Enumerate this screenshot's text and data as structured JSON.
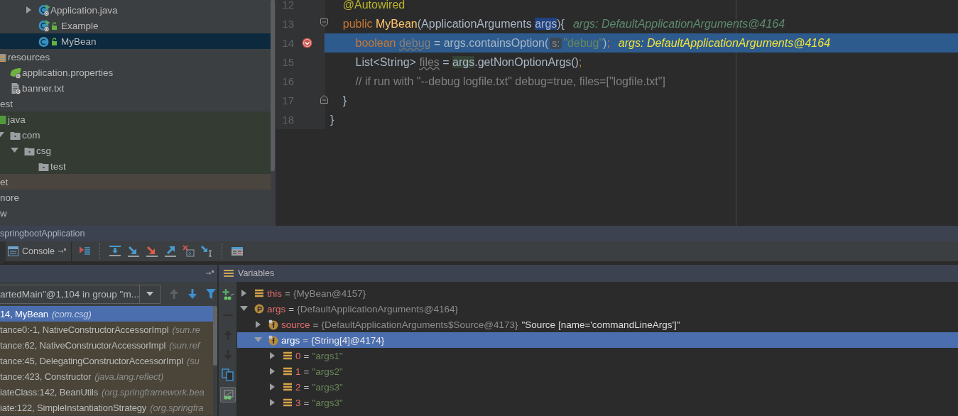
{
  "project_tree": [
    {
      "children": [
        {
          "children": [
            {
              "children": [
                {
                  "children": [
                    {
                      "label": "Application.java",
                      "kind": "spring-app",
                      "expanded": false,
                      "selected": false
                    },
                    {
                      "label": "Example",
                      "kind": "spring-app-public",
                      "selected": false
                    },
                    {
                      "label": "MyBean",
                      "kind": "class-public",
                      "selected": true
                    }
                  ]
                }
              ]
            }
          ]
        },
        {
          "label": "resources",
          "kind": "resources-folder",
          "selected": false,
          "children": [
            {
              "label": "application.properties",
              "kind": "spring-properties",
              "selected": false
            },
            {
              "label": "banner.txt",
              "kind": "text-file",
              "selected": false
            }
          ]
        }
      ]
    },
    {
      "label": "est",
      "selected": false,
      "children": [
        {
          "label": "java",
          "kind": "test-root",
          "selected": false,
          "children": [
            {
              "label": "com",
              "kind": "test-package",
              "expanded": true,
              "selected": false,
              "children": [
                {
                  "label": "csg",
                  "kind": "test-package",
                  "expanded": true,
                  "selected": false,
                  "children": [
                    {
                      "label": "test",
                      "kind": "test-package",
                      "selected": false
                    }
                  ]
                }
              ]
            }
          ]
        }
      ]
    },
    {
      "label": "et",
      "selected": false,
      "kind": "excluded"
    },
    {
      "label": "nore",
      "selected": false
    },
    {
      "label": "w",
      "selected": false
    }
  ],
  "editor": {
    "lines": [
      {
        "number": "12",
        "kind": "plain",
        "current": false,
        "breakpoint": false,
        "tokens": [
          {
            "kind": "annotation",
            "text": "    @Autowired"
          }
        ]
      },
      {
        "number": "13",
        "kind": "fold-start",
        "current": false,
        "breakpoint": false,
        "tokens": [
          {
            "kind": "keyword",
            "text": "    public "
          },
          {
            "kind": "function",
            "text": "MyBean"
          },
          {
            "kind": "plain",
            "text": "(ApplicationArguments "
          },
          {
            "kind": "usage",
            "text": "args"
          },
          {
            "kind": "plain",
            "text": "){"
          }
        ],
        "hint": "args: DefaultApplicationArguments@4164"
      },
      {
        "number": "14",
        "kind": "plain",
        "current": true,
        "breakpoint": true,
        "tokens": [
          {
            "kind": "keyword",
            "text": "        boolean "
          },
          {
            "kind": "unused",
            "text": "debug"
          },
          {
            "kind": "plain",
            "text": " = args.containsOption("
          },
          {
            "kind": "param-hint",
            "text": "s:"
          },
          {
            "kind": "string",
            "text": "\"debug\""
          },
          {
            "kind": "plain",
            "text": ")"
          },
          {
            "kind": "keyword",
            "text": ";"
          }
        ],
        "hint": "args: DefaultApplicationArguments@4164"
      },
      {
        "number": "15",
        "kind": "plain",
        "current": false,
        "breakpoint": false,
        "tokens": [
          {
            "kind": "plain",
            "text": "        List<String> "
          },
          {
            "kind": "unused",
            "text": "files"
          },
          {
            "kind": "plain",
            "text": " = "
          },
          {
            "kind": "read-usage",
            "text": "args"
          },
          {
            "kind": "plain",
            "text": ".getNonOptionArgs()"
          },
          {
            "kind": "keyword",
            "text": ";"
          }
        ]
      },
      {
        "number": "16",
        "kind": "plain",
        "current": false,
        "breakpoint": false,
        "tokens": [
          {
            "kind": "comment",
            "text": "        // if run with \"--debug logfile.txt\" debug=true, files=[\"logfile.txt\"]"
          }
        ]
      },
      {
        "number": "17",
        "kind": "fold-end",
        "current": false,
        "breakpoint": false,
        "tokens": [
          {
            "kind": "plain",
            "text": "    }"
          }
        ]
      },
      {
        "number": "18",
        "kind": "plain",
        "current": false,
        "breakpoint": false,
        "tokens": [
          {
            "kind": "plain",
            "text": "}"
          }
        ]
      }
    ]
  },
  "debug": {
    "run_config": "springbootApplication",
    "tabs": [
      {
        "label": "Console",
        "selected": false
      }
    ],
    "thread": "artedMain\"@1,104 in group \"m...",
    "frame_nav": [
      {
        "disabled": true
      },
      {
        "disabled": false
      }
    ],
    "watch_tools": [
      {
        "disabled": false,
        "on": false
      },
      {
        "disabled": true,
        "on": false
      },
      {
        "disabled": true,
        "on": false
      },
      {
        "disabled": true,
        "on": false
      },
      {
        "disabled": false,
        "on": false
      },
      {
        "disabled": false,
        "on": true
      }
    ],
    "frames": [
      {
        "location": "14, MyBean",
        "package": "(com.csg)",
        "selected": true,
        "library": false
      },
      {
        "location": "tance0:-1, NativeConstructorAccessorImpl",
        "package": "(sun.re",
        "selected": false,
        "library": true
      },
      {
        "location": "tance:62, NativeConstructorAccessorImpl",
        "package": "(sun.ref",
        "selected": false,
        "library": true
      },
      {
        "location": "tance:45, DelegatingConstructorAccessorImpl",
        "package": "(su",
        "selected": false,
        "library": true
      },
      {
        "location": "tance:423, Constructor",
        "package": "(java.lang.reflect)",
        "selected": false,
        "library": true
      },
      {
        "location": "iateClass:142, BeanUtils",
        "package": "(org.springframework.bea",
        "selected": false,
        "library": true
      },
      {
        "location": "iate:122, SimpleInstantiationStrategy",
        "package": "(org.springfra",
        "selected": false,
        "library": true
      }
    ],
    "variables_title": "Variables",
    "variables": [
      {
        "name": "this",
        "operator": "=",
        "value": "{MyBean@4157}",
        "kind": "element",
        "expanded": false,
        "selected": false
      },
      {
        "name": "args",
        "operator": "=",
        "value": "{DefaultApplicationArguments@4164}",
        "kind": "parameter",
        "expanded": true,
        "selected": false,
        "children": [
          {
            "name": "source",
            "operator": "=",
            "value": "{DefaultApplicationArguments$Source@4173}",
            "text": "\"Source [name='commandLineArgs']\"",
            "kind": "field",
            "expanded": false,
            "selected": false
          },
          {
            "name": "args",
            "operator": "=",
            "value": "{String[4]@4174}",
            "kind": "field",
            "expanded": true,
            "selected": true,
            "children": [
              {
                "name": "0",
                "operator": "=",
                "value": "\"args1\"",
                "kind": "string-element",
                "expanded": false,
                "selected": false
              },
              {
                "name": "1",
                "operator": "=",
                "value": "\"args2\"",
                "kind": "string-element",
                "expanded": false,
                "selected": false
              },
              {
                "name": "2",
                "operator": "=",
                "value": "\"args3\"",
                "kind": "string-element",
                "expanded": false,
                "selected": false
              },
              {
                "name": "3",
                "operator": "=",
                "value": "\"args3\"",
                "kind": "string-element",
                "expanded": false,
                "selected": false
              }
            ]
          }
        ]
      }
    ]
  }
}
